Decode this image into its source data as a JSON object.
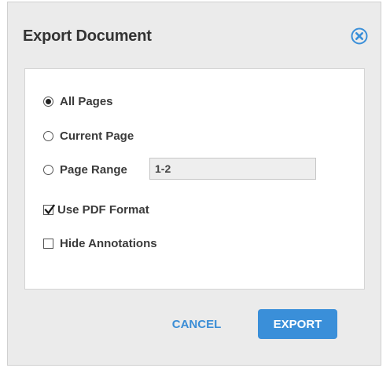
{
  "dialog": {
    "title": "Export Document",
    "accent_color": "#3a8fd9"
  },
  "options": {
    "all_pages": {
      "label": "All Pages",
      "checked": true
    },
    "current_page": {
      "label": "Current Page",
      "checked": false
    },
    "page_range": {
      "label": "Page Range",
      "checked": false,
      "value": "1-2"
    },
    "use_pdf": {
      "label": "Use PDF Format",
      "checked": true
    },
    "hide_annotations": {
      "label": "Hide Annotations",
      "checked": false
    }
  },
  "buttons": {
    "cancel": "CANCEL",
    "export": "EXPORT"
  }
}
